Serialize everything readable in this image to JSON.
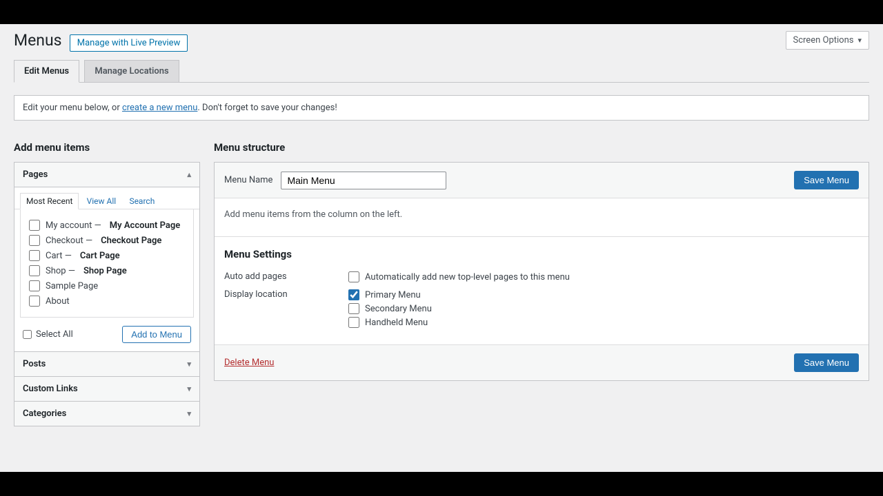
{
  "header": {
    "screen_options": "Screen Options",
    "title": "Menus",
    "preview_btn": "Manage with Live Preview"
  },
  "tabs": {
    "edit": "Edit Menus",
    "locations": "Manage Locations"
  },
  "info": {
    "prefix": "Edit your menu below, or ",
    "link": "create a new menu",
    "suffix": ". Don't forget to save your changes!"
  },
  "left": {
    "heading": "Add menu items",
    "pages": {
      "title": "Pages",
      "inner_tabs": {
        "recent": "Most Recent",
        "view_all": "View All",
        "search": "Search"
      },
      "items": [
        {
          "label": "My account —",
          "sub": "My Account Page"
        },
        {
          "label": "Checkout —",
          "sub": "Checkout Page"
        },
        {
          "label": "Cart —",
          "sub": "Cart Page"
        },
        {
          "label": "Shop —",
          "sub": "Shop Page"
        },
        {
          "label": "Sample Page",
          "sub": ""
        },
        {
          "label": "About",
          "sub": ""
        }
      ],
      "select_all": "Select All",
      "add_btn": "Add to Menu"
    },
    "collapsed": [
      "Posts",
      "Custom Links",
      "Categories"
    ]
  },
  "right": {
    "heading": "Menu structure",
    "menu_name_label": "Menu Name",
    "menu_name_value": "Main Menu",
    "save_btn": "Save Menu",
    "empty_hint": "Add menu items from the column on the left.",
    "settings": {
      "heading": "Menu Settings",
      "auto_label": "Auto add pages",
      "auto_opt": "Automatically add new top-level pages to this menu",
      "loc_label": "Display location",
      "loc_opts": [
        "Primary Menu",
        "Secondary Menu",
        "Handheld Menu"
      ]
    },
    "delete": "Delete Menu"
  }
}
